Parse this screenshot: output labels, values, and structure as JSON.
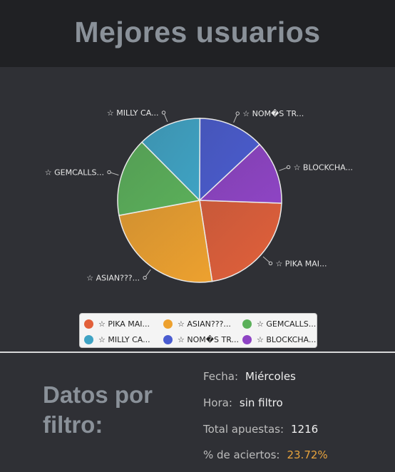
{
  "header": {
    "title": "Mejores usuarios"
  },
  "chart_data": {
    "type": "pie",
    "slices": [
      {
        "label": "☆ PIKA MAI...",
        "value": 22.0,
        "color": "#e2603a"
      },
      {
        "label": "☆ ASIAN???...",
        "value": 24.5,
        "color": "#eda12f"
      },
      {
        "label": "☆ GEMCALLS...",
        "value": 15.5,
        "color": "#5bb05a"
      },
      {
        "label": "☆ MILLY CA...",
        "value": 12.5,
        "color": "#3fa3c4"
      },
      {
        "label": "☆ NOM�S TR...",
        "value": 13.0,
        "color": "#4a5cd0"
      },
      {
        "label": "☆ BLOCKCHA...",
        "value": 12.5,
        "color": "#8e44c4"
      }
    ],
    "legend_position": "bottom"
  },
  "filter": {
    "heading": "Datos por filtro:",
    "fecha_label": "Fecha:",
    "fecha_value": "Miércoles",
    "hora_label": "Hora:",
    "hora_value": "sin filtro",
    "total_label": "Total apuestas:",
    "total_value": "1216",
    "aciertos_label": "% de aciertos:",
    "aciertos_value": "23.72%",
    "accent_color": "#e8a33d"
  }
}
